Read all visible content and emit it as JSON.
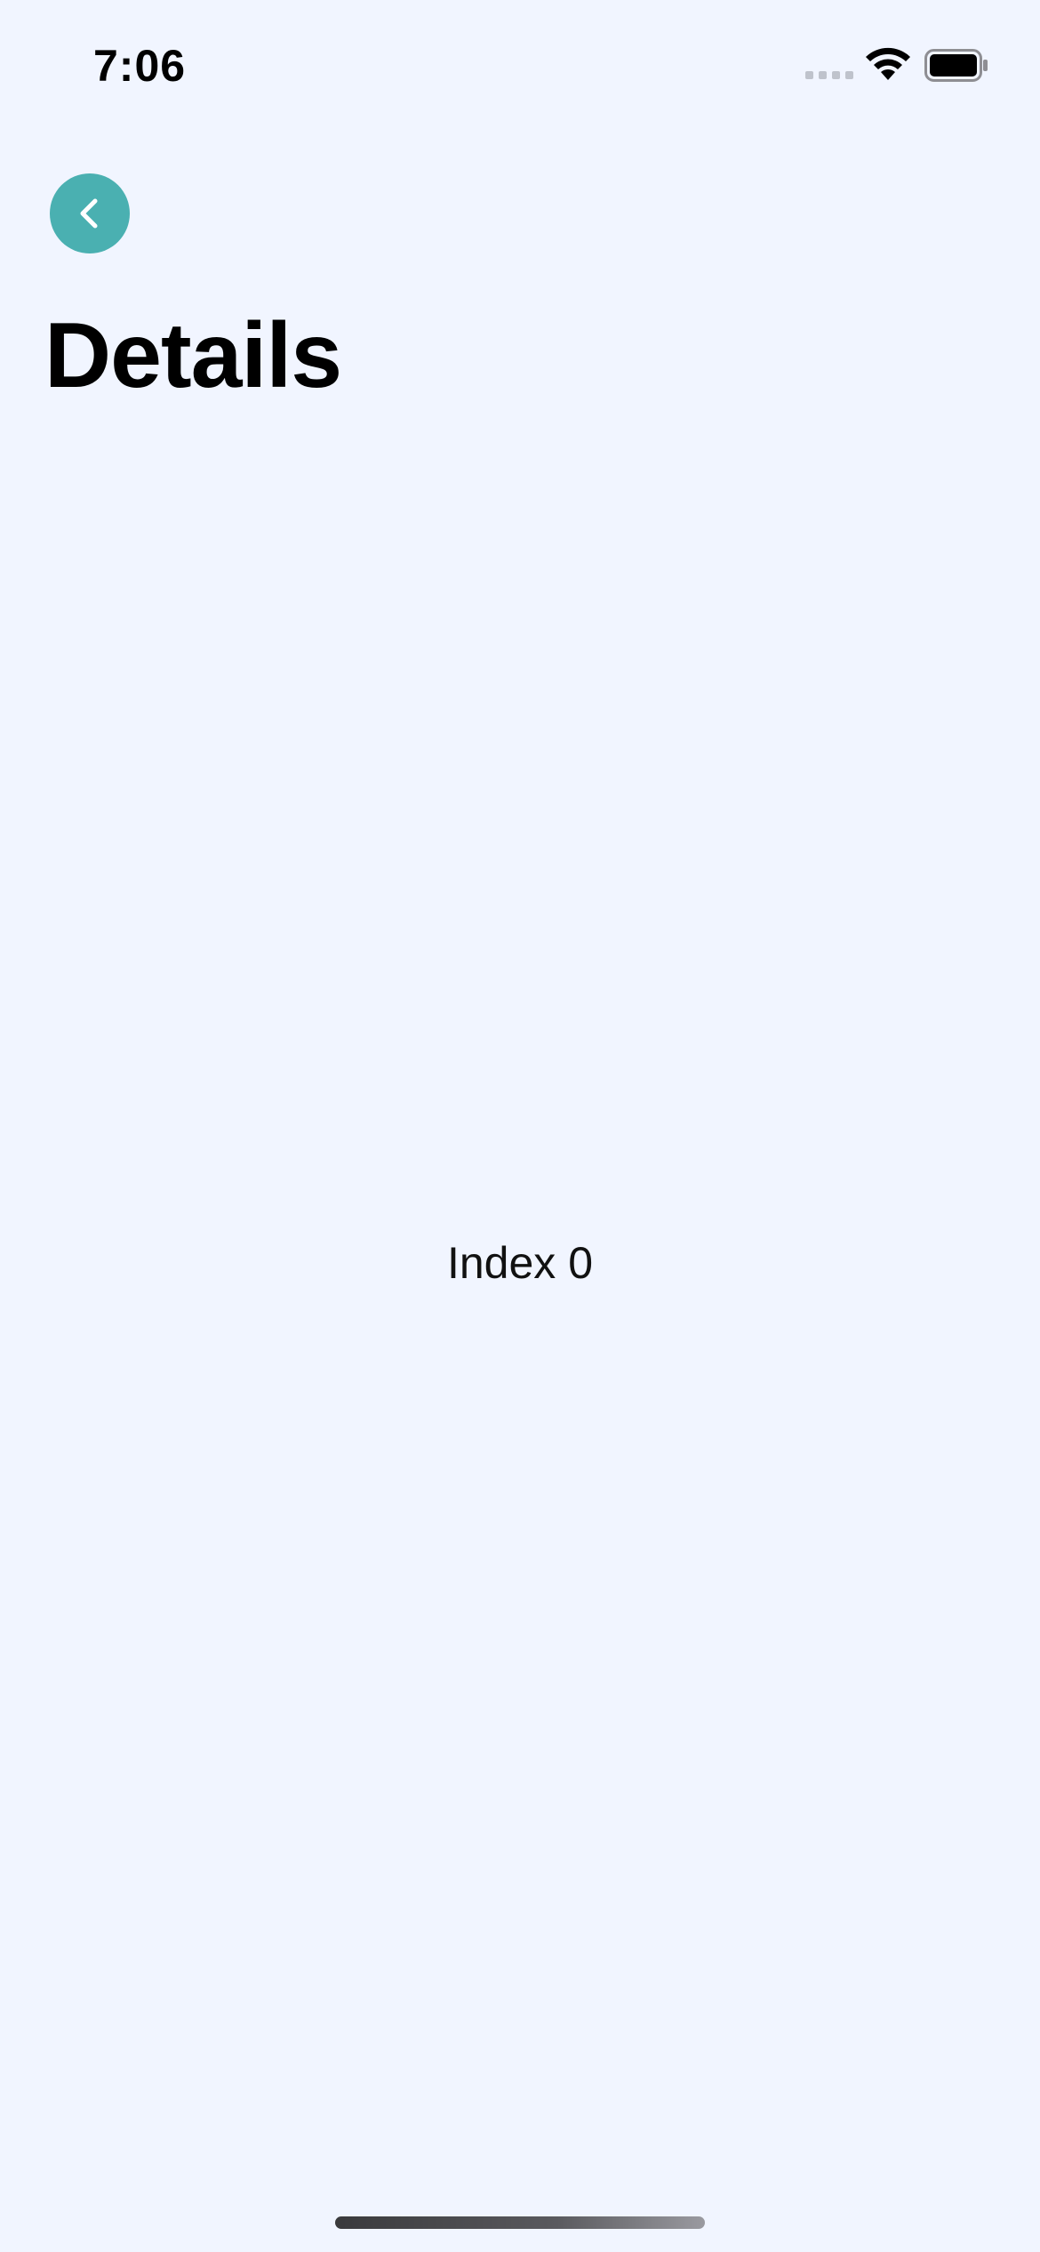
{
  "status_bar": {
    "time": "7:06",
    "signal_icon": "cellular-signal-icon",
    "wifi_icon": "wifi-icon",
    "battery_icon": "battery-icon"
  },
  "header": {
    "back_icon": "chevron-left-icon",
    "title": "Details"
  },
  "main": {
    "index_text": "Index 0"
  },
  "colors": {
    "background": "#F1F5FF",
    "accent": "#4AB0B1",
    "text": "#000000"
  }
}
